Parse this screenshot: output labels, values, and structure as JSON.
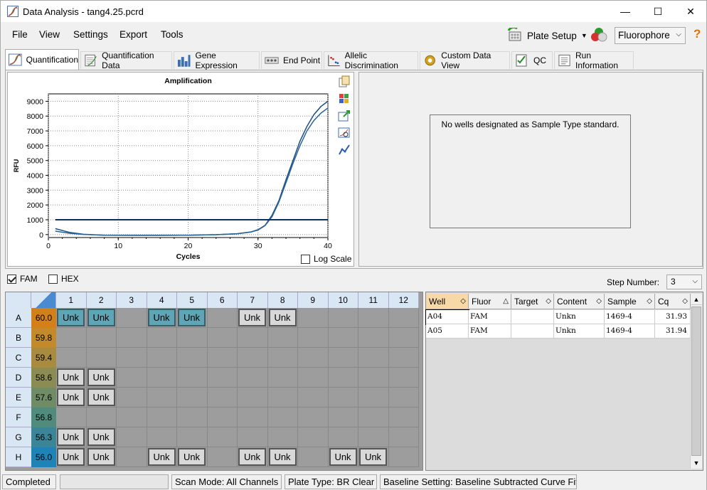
{
  "window": {
    "title": "Data Analysis - tang4.25.pcrd",
    "minimize": "—",
    "maximize": "☐",
    "close": "✕"
  },
  "menu": {
    "items": [
      "File",
      "View",
      "Settings",
      "Export",
      "Tools"
    ]
  },
  "toolbar": {
    "plate_setup": "Plate Setup",
    "fluorophore": "Fluorophore",
    "help": "?"
  },
  "tabs": [
    "Quantification",
    "Quantification Data",
    "Gene Expression",
    "End Point",
    "Allelic Discrimination",
    "Custom Data View",
    "QC",
    "Run Information"
  ],
  "chart_data": {
    "type": "line",
    "title": "Amplification",
    "xlabel": "Cycles",
    "ylabel": "RFU",
    "xlim": [
      0,
      40
    ],
    "ylim": [
      -200,
      9500
    ],
    "xticks": [
      0,
      10,
      20,
      30,
      40
    ],
    "yticks": [
      0,
      1000,
      2000,
      3000,
      4000,
      5000,
      6000,
      7000,
      8000,
      9000
    ],
    "grid": true,
    "threshold": 1000,
    "series": [
      {
        "x": [
          1,
          3,
          5,
          8,
          12,
          16,
          20,
          24,
          27,
          29,
          30,
          31,
          32,
          33,
          34,
          35,
          36,
          37,
          38,
          39,
          40
        ],
        "y": [
          400,
          150,
          20,
          -40,
          -50,
          -50,
          -40,
          -10,
          60,
          180,
          330,
          620,
          1300,
          2300,
          3700,
          5000,
          6300,
          7300,
          8100,
          8650,
          9000
        ]
      },
      {
        "x": [
          1,
          3,
          5,
          8,
          12,
          16,
          20,
          24,
          27,
          29,
          30,
          31,
          32,
          33,
          34,
          35,
          36,
          37,
          38,
          39,
          40
        ],
        "y": [
          230,
          90,
          10,
          -40,
          -50,
          -50,
          -40,
          -10,
          55,
          170,
          310,
          600,
          1200,
          2200,
          3500,
          4800,
          6000,
          7000,
          7700,
          8200,
          8550
        ]
      }
    ],
    "log_scale_label": "Log Scale"
  },
  "standard_panel": {
    "message": "No wells designated as Sample Type standard."
  },
  "channels": [
    {
      "label": "FAM",
      "checked": true
    },
    {
      "label": "HEX",
      "checked": false
    }
  ],
  "step": {
    "label": "Step Number:",
    "value": "3"
  },
  "plate": {
    "columns": [
      "1",
      "2",
      "3",
      "4",
      "5",
      "6",
      "7",
      "8",
      "9",
      "10",
      "11",
      "12"
    ],
    "rows": [
      {
        "label": "A",
        "temp": "60.0",
        "color": "#d57f18",
        "wells": [
          1,
          2,
          4,
          5,
          7,
          8
        ],
        "selected": [
          1,
          2,
          4,
          5
        ]
      },
      {
        "label": "B",
        "temp": "59.8",
        "color": "#c28a2a",
        "wells": [],
        "selected": []
      },
      {
        "label": "C",
        "temp": "59.4",
        "color": "#a98b3f",
        "wells": [],
        "selected": []
      },
      {
        "label": "D",
        "temp": "58.6",
        "color": "#8b8c52",
        "wells": [
          1,
          2
        ],
        "selected": []
      },
      {
        "label": "E",
        "temp": "57.6",
        "color": "#6f8c66",
        "wells": [
          1,
          2
        ],
        "selected": []
      },
      {
        "label": "F",
        "temp": "56.8",
        "color": "#508c7e",
        "wells": [],
        "selected": []
      },
      {
        "label": "G",
        "temp": "56.3",
        "color": "#3a8597",
        "wells": [
          1,
          2
        ],
        "selected": []
      },
      {
        "label": "H",
        "temp": "56.0",
        "color": "#1e84b8",
        "wells": [
          1,
          2,
          4,
          5,
          7,
          8,
          10,
          11
        ],
        "selected": []
      }
    ],
    "well_text": "Unk"
  },
  "results_table": {
    "headers": [
      "Well",
      "Fluor",
      "Target",
      "Content",
      "Sample",
      "Cq"
    ],
    "rows": [
      [
        "A04",
        "FAM",
        "",
        "Unkn",
        "1469-4",
        "31.93"
      ],
      [
        "A05",
        "FAM",
        "",
        "Unkn",
        "1469-4",
        "31.94"
      ]
    ]
  },
  "status": {
    "state": "Completed",
    "scan_mode": "Scan Mode: All Channels",
    "plate_type": "Plate Type: BR Clear",
    "baseline": "Baseline Setting: Baseline Subtracted Curve Fit"
  }
}
